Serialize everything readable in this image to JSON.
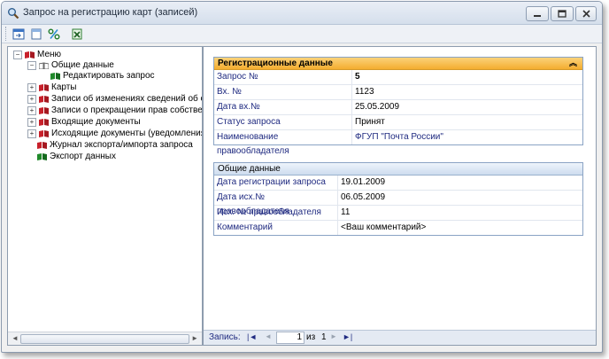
{
  "window": {
    "title": "Запрос на регистрацию карт (записей)"
  },
  "toolbar": {
    "buttons": [
      "import-icon",
      "new-document-icon",
      "percent-icon",
      "excel-export-icon"
    ]
  },
  "tree": {
    "root": "Меню",
    "items": [
      {
        "label": "Общие данные"
      },
      {
        "label": "Редактировать запрос"
      },
      {
        "label": "Карты"
      },
      {
        "label": "Записи об изменениях сведений об об"
      },
      {
        "label": "Записи о прекращении прав собствен"
      },
      {
        "label": "Входящие документы"
      },
      {
        "label": "Исходящие документы (уведомления,"
      },
      {
        "label": "Журнал экспорта/импорта запроса"
      },
      {
        "label": "Экспорт данных"
      }
    ],
    "colors": {
      "book_red": "#c8202a",
      "book_green": "#1f8a2a"
    }
  },
  "registration": {
    "header": "Регистрационные данные",
    "header_color": "#f4ad2f",
    "rows": [
      {
        "label": "Запрос №",
        "value": "5"
      },
      {
        "label": "Вх. №",
        "value": "1123"
      },
      {
        "label": "Дата вх.№",
        "value": "25.05.2009"
      },
      {
        "label": "Статус запроса",
        "value": "Принят"
      },
      {
        "label": "Наименование правообладателя",
        "value": "ФГУП \"Почта России\""
      }
    ]
  },
  "general": {
    "header": "Общие данные",
    "rows": [
      {
        "label": "Дата регистрации запроса",
        "value": "19.01.2009"
      },
      {
        "label": "Дата исх.№ правообладателя",
        "value": "06.05.2009"
      },
      {
        "label": "Исх. № правообладателя",
        "value": "11"
      },
      {
        "label": "Комментарий",
        "value": "<Ваш комментарий>"
      }
    ]
  },
  "navigator": {
    "label": "Запись:",
    "current": "1",
    "of": "из",
    "total": "1"
  }
}
